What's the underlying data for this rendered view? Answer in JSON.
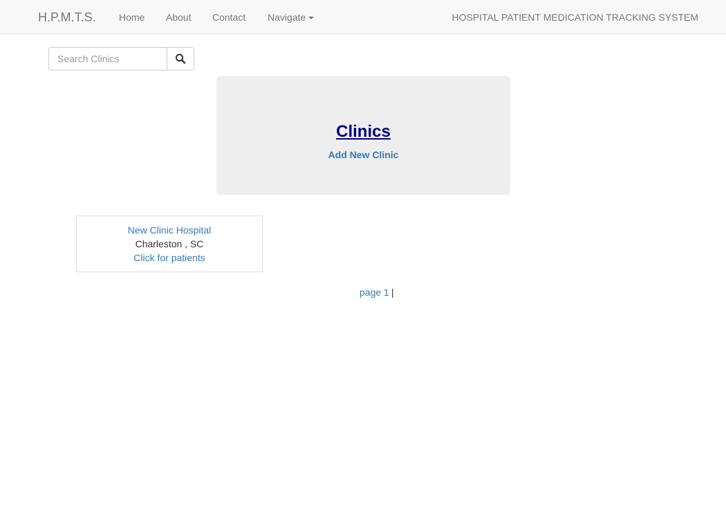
{
  "navbar": {
    "brand": "H.P.M.T.S.",
    "links": [
      "Home",
      "About",
      "Contact"
    ],
    "dropdown_label": "Navigate",
    "system_title": "HOSPITAL PATIENT MEDICATION TRACKING SYSTEM"
  },
  "search": {
    "placeholder": "Search Clinics",
    "value": "",
    "button_icon": "search-icon"
  },
  "jumbotron": {
    "title": "Clinics ",
    "add_link": "Add New Clinic"
  },
  "clinics": [
    {
      "name": "New Clinic Hospital",
      "location": "Charleston , SC",
      "patients_link": "Click for patients"
    }
  ],
  "pagination": {
    "page_label": "page 1",
    "separator": "|"
  },
  "colors": {
    "link": "#337ab7",
    "title": "#000080",
    "navbar_bg": "#f8f8f8",
    "jumbotron_bg": "#eeeeee"
  }
}
